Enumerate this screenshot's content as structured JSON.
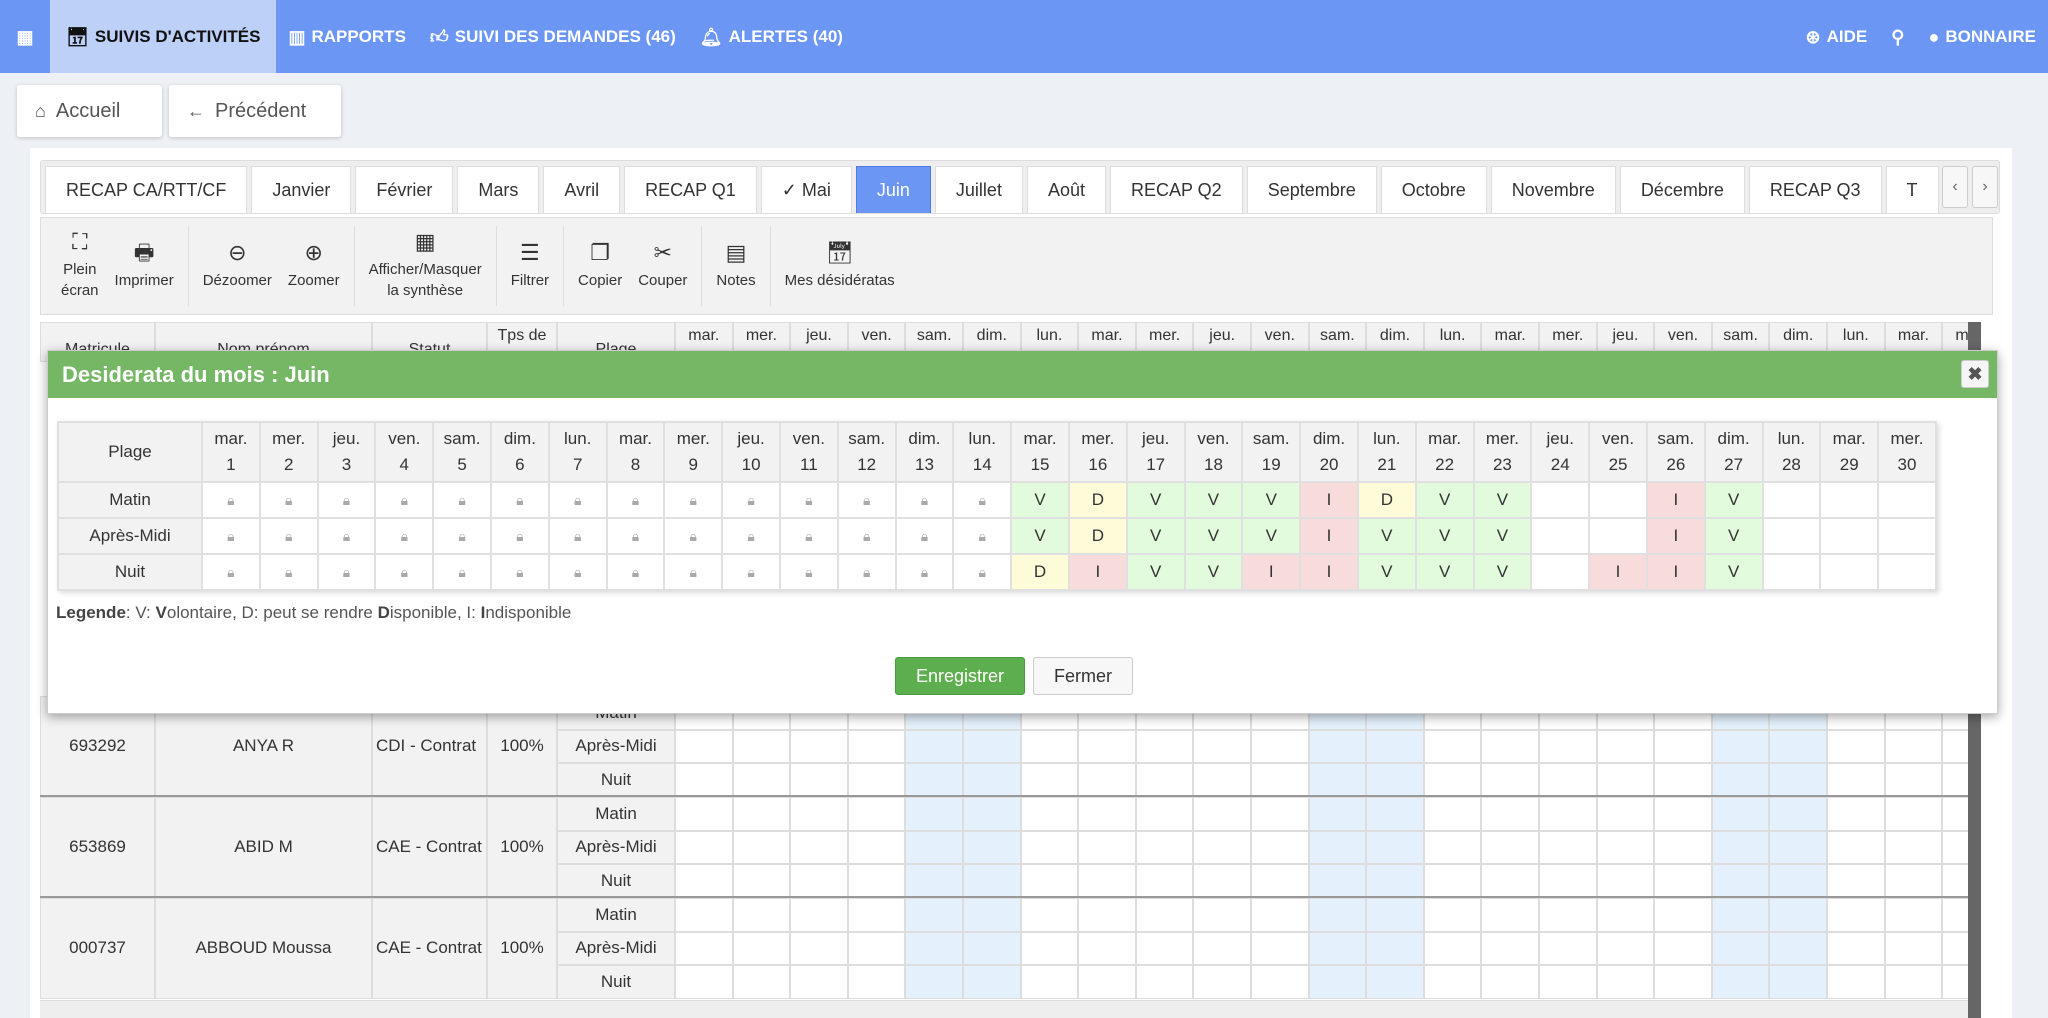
{
  "topnav": {
    "items": [
      {
        "label": "SUIVIS D'ACTIVITÉS",
        "icon": "calendar-icon",
        "active": true
      },
      {
        "label": "RAPPORTS",
        "icon": "bar-chart-icon"
      },
      {
        "label": "SUIVI DES DEMANDES (46)",
        "icon": "thumbs-icon"
      },
      {
        "label": "ALERTES (40)",
        "icon": "bell-icon"
      }
    ],
    "help": "AIDE",
    "user": "BONNAIRE"
  },
  "nav": {
    "home": "Accueil",
    "back": "Précédent"
  },
  "tabs": [
    "RECAP CA/RTT/CF",
    "Janvier",
    "Février",
    "Mars",
    "Avril",
    "RECAP Q1",
    "✓ Mai",
    "Juin",
    "Juillet",
    "Août",
    "RECAP Q2",
    "Septembre",
    "Octobre",
    "Novembre",
    "Décembre",
    "RECAP Q3",
    "T"
  ],
  "selected_tab": "Juin",
  "toolbar": [
    [
      {
        "label": "Plein\nécran",
        "icon": "fullscreen-icon"
      },
      {
        "label": "Imprimer",
        "icon": "print-icon"
      }
    ],
    [
      {
        "label": "Dézoomer",
        "icon": "zoom-out-icon"
      },
      {
        "label": "Zoomer",
        "icon": "zoom-in-icon"
      }
    ],
    [
      {
        "label": "Afficher/Masquer\nla synthèse",
        "icon": "grid-off-icon"
      }
    ],
    [
      {
        "label": "Filtrer",
        "icon": "filter-icon"
      }
    ],
    [
      {
        "label": "Copier",
        "icon": "copy-icon"
      },
      {
        "label": "Couper",
        "icon": "scissors-icon"
      }
    ],
    [
      {
        "label": "Notes",
        "icon": "notes-icon"
      }
    ],
    [
      {
        "label": "Mes désidératas",
        "icon": "calendar-check-icon"
      }
    ]
  ],
  "grid": {
    "headers": [
      "Matricule",
      "Nom prénom",
      "Statut",
      "Tps de",
      "Plage"
    ],
    "plages": [
      "Matin",
      "Après-Midi",
      "Nuit"
    ],
    "employees": [
      {
        "matricule": "693292",
        "nom": "ANYA R",
        "statut": "CDI - Contrat",
        "tps": "100%"
      },
      {
        "matricule": "653869",
        "nom": "ABID M",
        "statut": "CAE - Contrat",
        "tps": "100%"
      },
      {
        "matricule": "000737",
        "nom": "ABBOUD Moussa",
        "statut": "CAE - Contrat",
        "tps": "100%"
      }
    ]
  },
  "days": [
    "mar.",
    "mer.",
    "jeu.",
    "ven.",
    "sam.",
    "dim.",
    "lun.",
    "mar.",
    "mer.",
    "jeu.",
    "ven.",
    "sam.",
    "dim.",
    "lun.",
    "mar.",
    "mer.",
    "jeu.",
    "ven.",
    "sam.",
    "dim.",
    "lun.",
    "mar.",
    "mer.",
    "jeu.",
    "ven.",
    "sam.",
    "dim.",
    "lun.",
    "mar.",
    "mer."
  ],
  "modal": {
    "title": "Desiderata du mois : Juin",
    "plage_header": "Plage",
    "rows": [
      {
        "label": "Matin",
        "values": [
          "lock",
          "lock",
          "lock",
          "lock",
          "lock",
          "lock",
          "lock",
          "lock",
          "lock",
          "lock",
          "lock",
          "lock",
          "lock",
          "lock",
          "V",
          "D",
          "V",
          "V",
          "V",
          "I",
          "D",
          "V",
          "V",
          "",
          "",
          "I",
          "V",
          "",
          "",
          ""
        ]
      },
      {
        "label": "Après-Midi",
        "values": [
          "lock",
          "lock",
          "lock",
          "lock",
          "lock",
          "lock",
          "lock",
          "lock",
          "lock",
          "lock",
          "lock",
          "lock",
          "lock",
          "lock",
          "V",
          "D",
          "V",
          "V",
          "V",
          "I",
          "V",
          "V",
          "V",
          "",
          "",
          "I",
          "V",
          "",
          "",
          ""
        ]
      },
      {
        "label": "Nuit",
        "values": [
          "lock",
          "lock",
          "lock",
          "lock",
          "lock",
          "lock",
          "lock",
          "lock",
          "lock",
          "lock",
          "lock",
          "lock",
          "lock",
          "lock",
          "D",
          "I",
          "V",
          "V",
          "I",
          "I",
          "V",
          "V",
          "V",
          "",
          "I",
          "I",
          "V",
          "",
          "",
          ""
        ]
      }
    ],
    "legend": {
      "title": "Legende",
      "parts": [
        ": V: ",
        "V",
        "olontaire, D: peut se rendre ",
        "D",
        "isponible, I: ",
        "I",
        "ndisponible"
      ]
    },
    "save": "Enregistrer",
    "close": "Fermer"
  },
  "colors": {
    "nav": "#6b96f3",
    "V": "#e2fbdc",
    "D": "#fefbd8",
    "I": "#f8dcdc",
    "weekend": "#e4f0fb",
    "modal_header": "#76b766"
  }
}
